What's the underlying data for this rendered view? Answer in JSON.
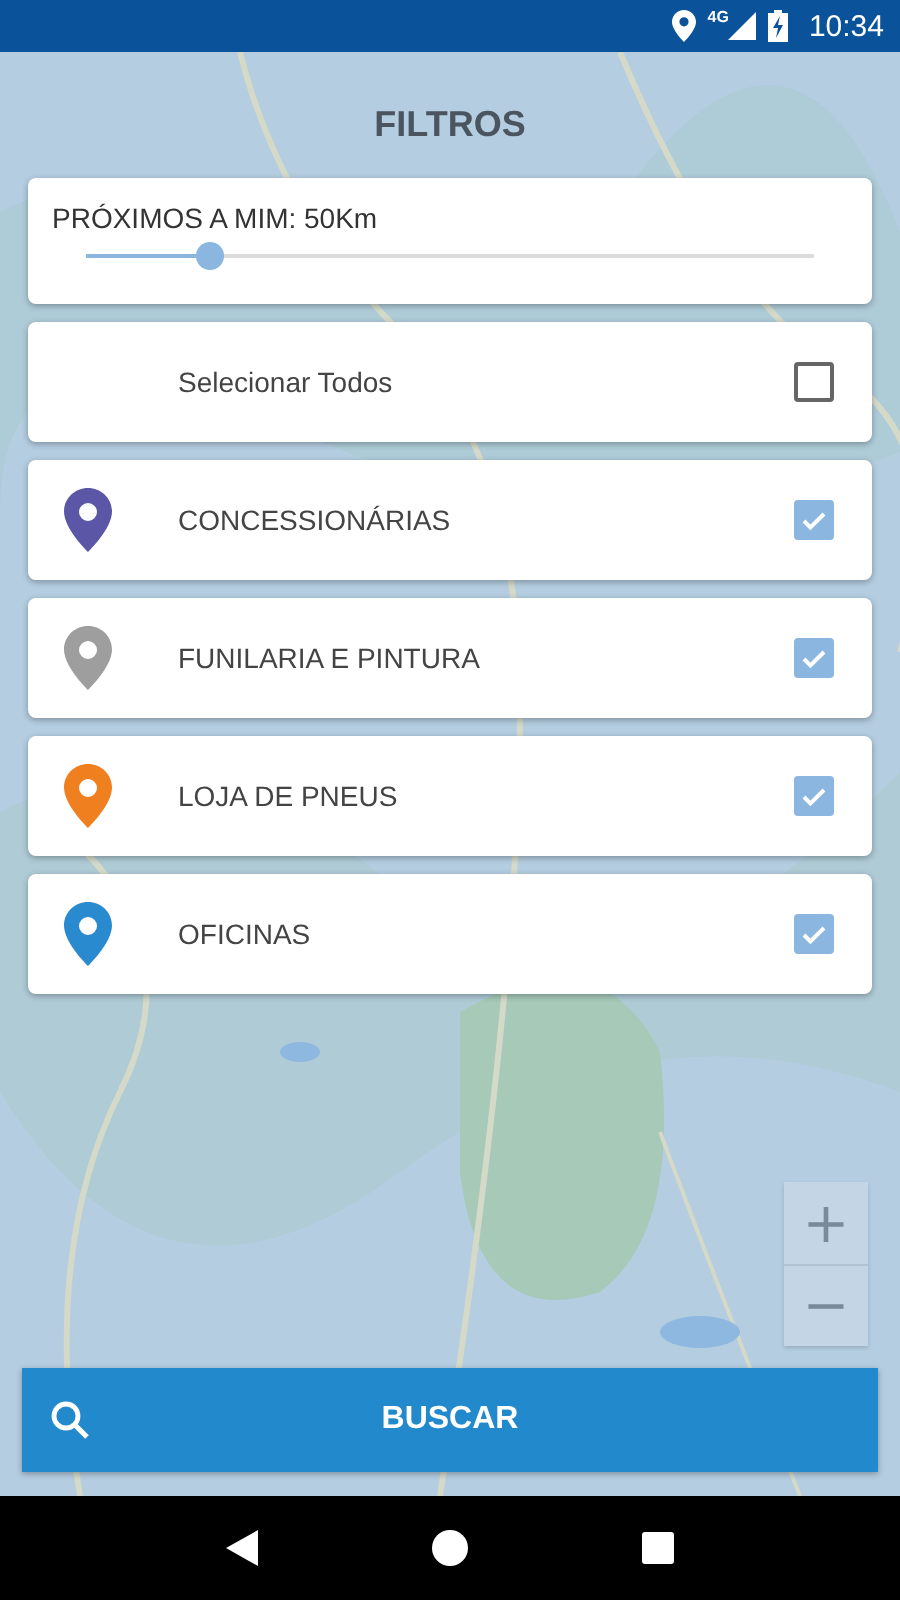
{
  "status_bar": {
    "network": "4G",
    "time": "10:34"
  },
  "title": "FILTROS",
  "distance": {
    "label": "PRÓXIMOS A MIM: 50Km",
    "level": 0.17
  },
  "select_all": {
    "label": "Selecionar Todos",
    "checked": false
  },
  "categories": [
    {
      "label": "CONCESSIONÁRIAS",
      "color": "#5b57a6",
      "checked": true
    },
    {
      "label": "FUNILARIA E PINTURA",
      "color": "#9e9e9e",
      "checked": true
    },
    {
      "label": "LOJA DE PNEUS",
      "color": "#f0801f",
      "checked": true
    },
    {
      "label": "OFICINAS",
      "color": "#2a8ad0",
      "checked": true
    }
  ],
  "zoom_controls": [
    "+",
    "−"
  ],
  "search_button": "BUSCAR"
}
